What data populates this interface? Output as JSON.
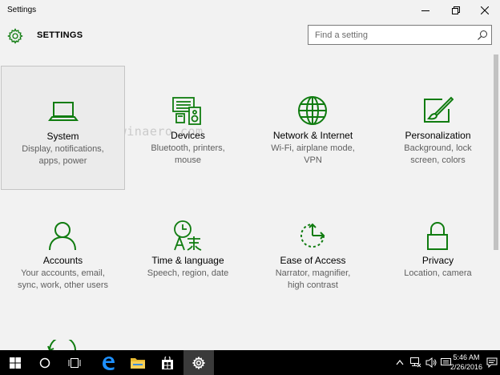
{
  "window": {
    "title": "Settings",
    "controls": [
      "minimize",
      "restore",
      "close"
    ]
  },
  "header": {
    "heading": "SETTINGS",
    "search_placeholder": "Find a setting"
  },
  "watermark": {
    "text": "http://winaero.com"
  },
  "tiles": [
    {
      "name": "System",
      "desc1": "Display, notifications,",
      "desc2": "apps, power",
      "icon": "laptop-icon"
    },
    {
      "name": "Devices",
      "desc1": "Bluetooth, printers,",
      "desc2": "mouse",
      "icon": "devices-icon"
    },
    {
      "name": "Network & Internet",
      "desc1": "Wi-Fi, airplane mode,",
      "desc2": "VPN",
      "icon": "globe-icon"
    },
    {
      "name": "Personalization",
      "desc1": "Background, lock",
      "desc2": "screen, colors",
      "icon": "paint-icon"
    },
    {
      "name": "Accounts",
      "desc1": "Your accounts, email,",
      "desc2": "sync, work, other users",
      "icon": "person-icon"
    },
    {
      "name": "Time & language",
      "desc1": "Speech, region, date",
      "desc2": "",
      "icon": "time-language-icon"
    },
    {
      "name": "Ease of Access",
      "desc1": "Narrator, magnifier,",
      "desc2": "high contrast",
      "icon": "ease-of-access-icon"
    },
    {
      "name": "Privacy",
      "desc1": "Location, camera",
      "desc2": "",
      "icon": "lock-icon"
    }
  ],
  "taskbar": {
    "time": "5:46 AM",
    "date": "2/26/2016"
  },
  "colors": {
    "accent": "#107c10",
    "background": "#f2f2f2",
    "taskbar": "#000000"
  }
}
